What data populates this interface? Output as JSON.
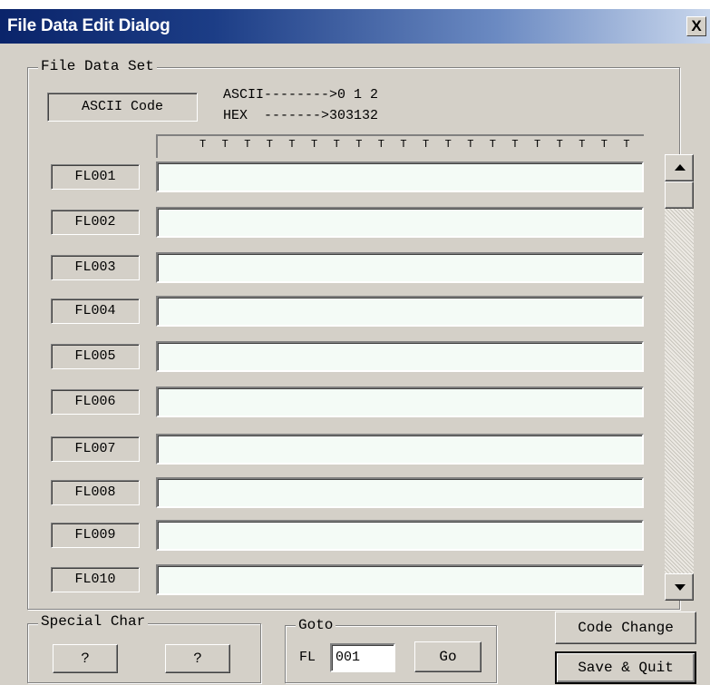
{
  "window": {
    "title": "File Data Edit Dialog",
    "close_label": "X"
  },
  "file_data_set": {
    "legend": "File Data Set",
    "code_button": "ASCII Code",
    "hint_ascii": "ASCII-------->0 1 2",
    "hint_hex": "HEX  ------->303132",
    "ruler_char": "T",
    "ruler_count": 20,
    "rows": [
      {
        "label": "FL001",
        "value": ""
      },
      {
        "label": "FL002",
        "value": ""
      },
      {
        "label": "FL003",
        "value": ""
      },
      {
        "label": "FL004",
        "value": ""
      },
      {
        "label": "FL005",
        "value": ""
      },
      {
        "label": "FL006",
        "value": ""
      },
      {
        "label": "FL007",
        "value": ""
      },
      {
        "label": "FL008",
        "value": ""
      },
      {
        "label": "FL009",
        "value": ""
      },
      {
        "label": "FL010",
        "value": ""
      }
    ]
  },
  "special_char": {
    "legend": "Special Char",
    "button1": "?",
    "button2": "?"
  },
  "goto": {
    "legend": "Goto",
    "prefix": "FL",
    "value": "001",
    "go_label": "Go"
  },
  "actions": {
    "code_change": "Code Change",
    "save_quit": "Save & Quit"
  }
}
